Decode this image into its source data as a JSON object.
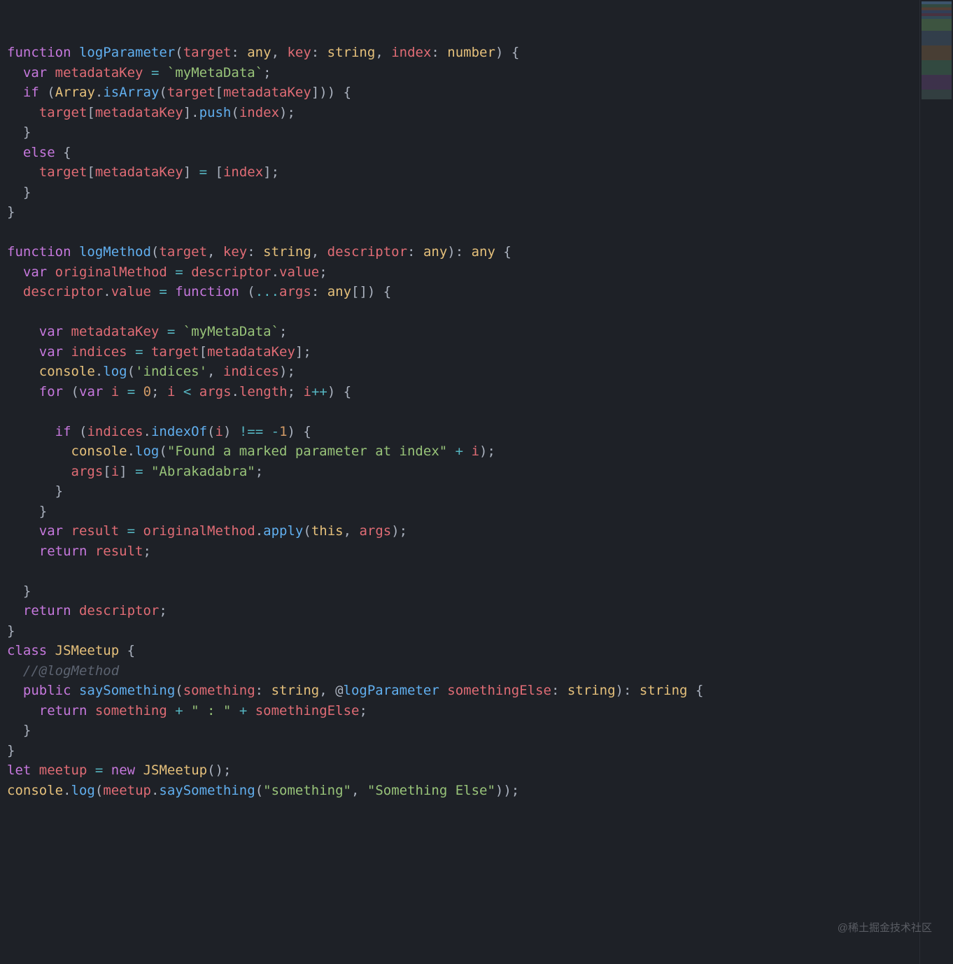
{
  "code": {
    "lines": [
      {
        "indent": 0,
        "tokens": [
          [
            "kw",
            "function"
          ],
          [
            "white",
            " "
          ],
          [
            "fn",
            "logParameter"
          ],
          [
            "punct",
            "("
          ],
          [
            "param",
            "target"
          ],
          [
            "punct",
            ": "
          ],
          [
            "type",
            "any"
          ],
          [
            "punct",
            ", "
          ],
          [
            "param",
            "key"
          ],
          [
            "punct",
            ": "
          ],
          [
            "type",
            "string"
          ],
          [
            "punct",
            ", "
          ],
          [
            "param",
            "index"
          ],
          [
            "punct",
            ": "
          ],
          [
            "type",
            "number"
          ],
          [
            "punct",
            ") {"
          ]
        ]
      },
      {
        "indent": 1,
        "tokens": [
          [
            "kw",
            "var"
          ],
          [
            "white",
            " "
          ],
          [
            "ident",
            "metadataKey"
          ],
          [
            "white",
            " "
          ],
          [
            "op",
            "="
          ],
          [
            "white",
            " "
          ],
          [
            "tmpl",
            "`myMetaData`"
          ],
          [
            "punct",
            ";"
          ]
        ]
      },
      {
        "indent": 1,
        "tokens": [
          [
            "kw",
            "if"
          ],
          [
            "white",
            " "
          ],
          [
            "punct",
            "("
          ],
          [
            "type",
            "Array"
          ],
          [
            "punct",
            "."
          ],
          [
            "fn",
            "isArray"
          ],
          [
            "punct",
            "("
          ],
          [
            "ident",
            "target"
          ],
          [
            "punct",
            "["
          ],
          [
            "ident",
            "metadataKey"
          ],
          [
            "punct",
            "])) {"
          ]
        ]
      },
      {
        "indent": 2,
        "tokens": [
          [
            "ident",
            "target"
          ],
          [
            "punct",
            "["
          ],
          [
            "ident",
            "metadataKey"
          ],
          [
            "punct",
            "]."
          ],
          [
            "fn",
            "push"
          ],
          [
            "punct",
            "("
          ],
          [
            "ident",
            "index"
          ],
          [
            "punct",
            ");"
          ]
        ]
      },
      {
        "indent": 1,
        "tokens": [
          [
            "punct",
            "}"
          ]
        ]
      },
      {
        "indent": 1,
        "tokens": [
          [
            "kw",
            "else"
          ],
          [
            "white",
            " {"
          ]
        ]
      },
      {
        "indent": 2,
        "tokens": [
          [
            "ident",
            "target"
          ],
          [
            "punct",
            "["
          ],
          [
            "ident",
            "metadataKey"
          ],
          [
            "punct",
            "] "
          ],
          [
            "op",
            "="
          ],
          [
            "punct",
            " ["
          ],
          [
            "ident",
            "index"
          ],
          [
            "punct",
            "];"
          ]
        ]
      },
      {
        "indent": 1,
        "tokens": [
          [
            "punct",
            "}"
          ]
        ]
      },
      {
        "indent": 0,
        "tokens": [
          [
            "punct",
            "}"
          ]
        ]
      },
      {
        "indent": 0,
        "tokens": []
      },
      {
        "indent": 0,
        "tokens": [
          [
            "kw",
            "function"
          ],
          [
            "white",
            " "
          ],
          [
            "fn",
            "logMethod"
          ],
          [
            "punct",
            "("
          ],
          [
            "param",
            "target"
          ],
          [
            "punct",
            ", "
          ],
          [
            "param",
            "key"
          ],
          [
            "punct",
            ": "
          ],
          [
            "type",
            "string"
          ],
          [
            "punct",
            ", "
          ],
          [
            "param",
            "descriptor"
          ],
          [
            "punct",
            ": "
          ],
          [
            "type",
            "any"
          ],
          [
            "punct",
            "): "
          ],
          [
            "type",
            "any"
          ],
          [
            "white",
            " {"
          ]
        ]
      },
      {
        "indent": 1,
        "tokens": [
          [
            "kw",
            "var"
          ],
          [
            "white",
            " "
          ],
          [
            "ident",
            "originalMethod"
          ],
          [
            "white",
            " "
          ],
          [
            "op",
            "="
          ],
          [
            "white",
            " "
          ],
          [
            "ident",
            "descriptor"
          ],
          [
            "punct",
            "."
          ],
          [
            "prop",
            "value"
          ],
          [
            "punct",
            ";"
          ]
        ]
      },
      {
        "indent": 1,
        "tokens": [
          [
            "ident",
            "descriptor"
          ],
          [
            "punct",
            "."
          ],
          [
            "prop",
            "value"
          ],
          [
            "white",
            " "
          ],
          [
            "op",
            "="
          ],
          [
            "white",
            " "
          ],
          [
            "kw",
            "function"
          ],
          [
            "white",
            " "
          ],
          [
            "punct",
            "("
          ],
          [
            "op",
            "..."
          ],
          [
            "param",
            "args"
          ],
          [
            "punct",
            ": "
          ],
          [
            "type",
            "any"
          ],
          [
            "punct",
            "[]) {"
          ]
        ]
      },
      {
        "indent": 2,
        "tokens": []
      },
      {
        "indent": 2,
        "tokens": [
          [
            "kw",
            "var"
          ],
          [
            "white",
            " "
          ],
          [
            "ident",
            "metadataKey"
          ],
          [
            "white",
            " "
          ],
          [
            "op",
            "="
          ],
          [
            "white",
            " "
          ],
          [
            "tmpl",
            "`myMetaData`"
          ],
          [
            "punct",
            ";"
          ]
        ]
      },
      {
        "indent": 2,
        "tokens": [
          [
            "kw",
            "var"
          ],
          [
            "white",
            " "
          ],
          [
            "ident",
            "indices"
          ],
          [
            "white",
            " "
          ],
          [
            "op",
            "="
          ],
          [
            "white",
            " "
          ],
          [
            "ident",
            "target"
          ],
          [
            "punct",
            "["
          ],
          [
            "ident",
            "metadataKey"
          ],
          [
            "punct",
            "];"
          ]
        ]
      },
      {
        "indent": 2,
        "tokens": [
          [
            "obj",
            "console"
          ],
          [
            "punct",
            "."
          ],
          [
            "fn",
            "log"
          ],
          [
            "punct",
            "("
          ],
          [
            "str",
            "'indices'"
          ],
          [
            "punct",
            ", "
          ],
          [
            "ident",
            "indices"
          ],
          [
            "punct",
            ");"
          ]
        ]
      },
      {
        "indent": 2,
        "tokens": [
          [
            "kw",
            "for"
          ],
          [
            "white",
            " "
          ],
          [
            "punct",
            "("
          ],
          [
            "kw",
            "var"
          ],
          [
            "white",
            " "
          ],
          [
            "ident",
            "i"
          ],
          [
            "white",
            " "
          ],
          [
            "op",
            "="
          ],
          [
            "white",
            " "
          ],
          [
            "num",
            "0"
          ],
          [
            "punct",
            "; "
          ],
          [
            "ident",
            "i"
          ],
          [
            "white",
            " "
          ],
          [
            "op",
            "<"
          ],
          [
            "white",
            " "
          ],
          [
            "ident",
            "args"
          ],
          [
            "punct",
            "."
          ],
          [
            "prop",
            "length"
          ],
          [
            "punct",
            "; "
          ],
          [
            "ident",
            "i"
          ],
          [
            "op",
            "++"
          ],
          [
            "punct",
            ") {"
          ]
        ]
      },
      {
        "indent": 3,
        "tokens": []
      },
      {
        "indent": 3,
        "tokens": [
          [
            "kw",
            "if"
          ],
          [
            "white",
            " "
          ],
          [
            "punct",
            "("
          ],
          [
            "ident",
            "indices"
          ],
          [
            "punct",
            "."
          ],
          [
            "fn",
            "indexOf"
          ],
          [
            "punct",
            "("
          ],
          [
            "ident",
            "i"
          ],
          [
            "punct",
            ") "
          ],
          [
            "op",
            "!=="
          ],
          [
            "white",
            " "
          ],
          [
            "op",
            "-"
          ],
          [
            "num",
            "1"
          ],
          [
            "punct",
            ") {"
          ]
        ]
      },
      {
        "indent": 4,
        "tokens": [
          [
            "obj",
            "console"
          ],
          [
            "punct",
            "."
          ],
          [
            "fn",
            "log"
          ],
          [
            "punct",
            "("
          ],
          [
            "str",
            "\"Found a marked parameter at index\""
          ],
          [
            "white",
            " "
          ],
          [
            "op",
            "+"
          ],
          [
            "white",
            " "
          ],
          [
            "ident",
            "i"
          ],
          [
            "punct",
            ");"
          ]
        ]
      },
      {
        "indent": 4,
        "tokens": [
          [
            "ident",
            "args"
          ],
          [
            "punct",
            "["
          ],
          [
            "ident",
            "i"
          ],
          [
            "punct",
            "] "
          ],
          [
            "op",
            "="
          ],
          [
            "white",
            " "
          ],
          [
            "str",
            "\"Abrakadabra\""
          ],
          [
            "punct",
            ";"
          ]
        ]
      },
      {
        "indent": 3,
        "tokens": [
          [
            "punct",
            "}"
          ]
        ]
      },
      {
        "indent": 2,
        "tokens": [
          [
            "punct",
            "}"
          ]
        ]
      },
      {
        "indent": 2,
        "tokens": [
          [
            "kw",
            "var"
          ],
          [
            "white",
            " "
          ],
          [
            "ident",
            "result"
          ],
          [
            "white",
            " "
          ],
          [
            "op",
            "="
          ],
          [
            "white",
            " "
          ],
          [
            "ident",
            "originalMethod"
          ],
          [
            "punct",
            "."
          ],
          [
            "fn",
            "apply"
          ],
          [
            "punct",
            "("
          ],
          [
            "this",
            "this"
          ],
          [
            "punct",
            ", "
          ],
          [
            "ident",
            "args"
          ],
          [
            "punct",
            ");"
          ]
        ]
      },
      {
        "indent": 2,
        "tokens": [
          [
            "kw",
            "return"
          ],
          [
            "white",
            " "
          ],
          [
            "ident",
            "result"
          ],
          [
            "punct",
            ";"
          ]
        ]
      },
      {
        "indent": 2,
        "tokens": []
      },
      {
        "indent": 1,
        "tokens": [
          [
            "punct",
            "}"
          ]
        ]
      },
      {
        "indent": 1,
        "tokens": [
          [
            "kw",
            "return"
          ],
          [
            "white",
            " "
          ],
          [
            "ident",
            "descriptor"
          ],
          [
            "punct",
            ";"
          ]
        ]
      },
      {
        "indent": 0,
        "tokens": [
          [
            "punct",
            "}"
          ]
        ]
      },
      {
        "indent": 0,
        "tokens": [
          [
            "kw",
            "class"
          ],
          [
            "white",
            " "
          ],
          [
            "type",
            "JSMeetup"
          ],
          [
            "white",
            " {"
          ]
        ]
      },
      {
        "indent": 1,
        "tokens": [
          [
            "comment",
            "//@logMethod"
          ]
        ]
      },
      {
        "indent": 1,
        "tokens": [
          [
            "kw",
            "public"
          ],
          [
            "white",
            " "
          ],
          [
            "fn",
            "saySomething"
          ],
          [
            "punct",
            "("
          ],
          [
            "param",
            "something"
          ],
          [
            "punct",
            ": "
          ],
          [
            "type",
            "string"
          ],
          [
            "punct",
            ", "
          ],
          [
            "punct",
            "@"
          ],
          [
            "fn",
            "logParameter"
          ],
          [
            "white",
            " "
          ],
          [
            "param",
            "somethingElse"
          ],
          [
            "punct",
            ": "
          ],
          [
            "type",
            "string"
          ],
          [
            "punct",
            "): "
          ],
          [
            "type",
            "string"
          ],
          [
            "white",
            " "
          ],
          [
            "punct",
            "{"
          ]
        ]
      },
      {
        "indent": 2,
        "tokens": [
          [
            "kw",
            "return"
          ],
          [
            "white",
            " "
          ],
          [
            "ident",
            "something"
          ],
          [
            "white",
            " "
          ],
          [
            "op",
            "+"
          ],
          [
            "white",
            " "
          ],
          [
            "str",
            "\" : \""
          ],
          [
            "white",
            " "
          ],
          [
            "op",
            "+"
          ],
          [
            "white",
            " "
          ],
          [
            "ident",
            "somethingElse"
          ],
          [
            "punct",
            ";"
          ]
        ]
      },
      {
        "indent": 1,
        "tokens": [
          [
            "punct",
            "}"
          ]
        ]
      },
      {
        "indent": 0,
        "tokens": [
          [
            "punct",
            "}"
          ]
        ]
      },
      {
        "indent": 0,
        "tokens": [
          [
            "kw",
            "let"
          ],
          [
            "white",
            " "
          ],
          [
            "ident",
            "meetup"
          ],
          [
            "white",
            " "
          ],
          [
            "op",
            "="
          ],
          [
            "white",
            " "
          ],
          [
            "kw",
            "new"
          ],
          [
            "white",
            " "
          ],
          [
            "type",
            "JSMeetup"
          ],
          [
            "punct",
            "();"
          ]
        ]
      },
      {
        "indent": 0,
        "tokens": [
          [
            "obj",
            "console"
          ],
          [
            "punct",
            "."
          ],
          [
            "fn",
            "log"
          ],
          [
            "punct",
            "("
          ],
          [
            "ident",
            "meetup"
          ],
          [
            "punct",
            "."
          ],
          [
            "fn",
            "saySomething"
          ],
          [
            "punct",
            "("
          ],
          [
            "str",
            "\"something\""
          ],
          [
            "punct",
            ", "
          ],
          [
            "str",
            "\"Something Else\""
          ],
          [
            "punct",
            "));"
          ]
        ]
      }
    ]
  },
  "watermark": "@稀土掘金技术社区"
}
